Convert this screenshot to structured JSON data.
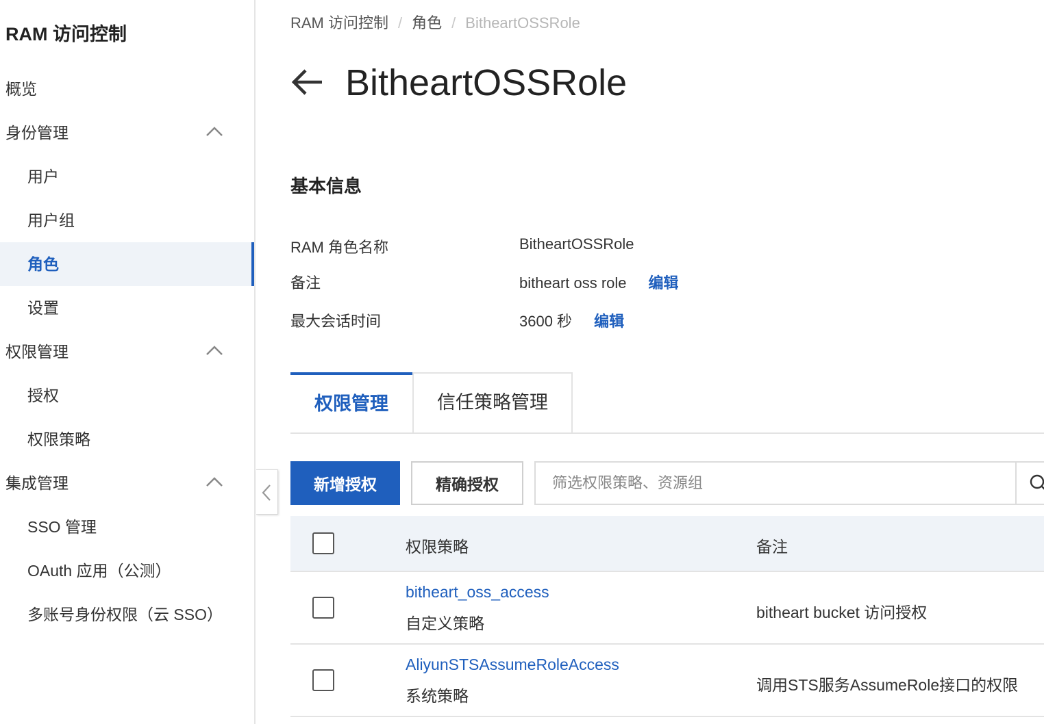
{
  "sidebar": {
    "title": "RAM 访问控制",
    "items": [
      {
        "label": "概览"
      },
      {
        "label": "身份管理"
      },
      {
        "label": "用户"
      },
      {
        "label": "用户组"
      },
      {
        "label": "角色"
      },
      {
        "label": "设置"
      },
      {
        "label": "权限管理"
      },
      {
        "label": "授权"
      },
      {
        "label": "权限策略"
      },
      {
        "label": "集成管理"
      },
      {
        "label": "SSO 管理"
      },
      {
        "label": "OAuth 应用（公测）"
      },
      {
        "label": "多账号身份权限（云 SSO）"
      }
    ],
    "active_item": "角色"
  },
  "breadcrumb": {
    "items": [
      "RAM 访问控制",
      "角色",
      "BitheartOSSRole"
    ],
    "separator": "/"
  },
  "page": {
    "title": "BitheartOSSRole"
  },
  "basic_info": {
    "title": "基本信息",
    "rows": [
      {
        "label": "RAM 角色名称",
        "value": "BitheartOSSRole"
      },
      {
        "label": "备注",
        "value": "bitheart oss role",
        "action": "编辑"
      },
      {
        "label": "最大会话时间",
        "value": "3600 秒",
        "action": "编辑"
      }
    ]
  },
  "tabs": [
    {
      "label": "权限管理",
      "active": true
    },
    {
      "label": "信任策略管理",
      "active": false
    }
  ],
  "toolbar": {
    "add_label": "新增授权",
    "precise_label": "精确授权",
    "search_placeholder": "筛选权限策略、资源组"
  },
  "table": {
    "headers": {
      "policy": "权限策略",
      "note": "备注"
    },
    "rows": [
      {
        "name": "bitheart_oss_access",
        "type": "自定义策略",
        "note": "bitheart bucket 访问授权"
      },
      {
        "name": "AliyunSTSAssumeRoleAccess",
        "type": "系统策略",
        "note": "调用STS服务AssumeRole接口的权限"
      }
    ]
  },
  "colors": {
    "accent": "#1f5fbd",
    "active_bg": "#eff3f8",
    "border": "#e3e3e3"
  }
}
